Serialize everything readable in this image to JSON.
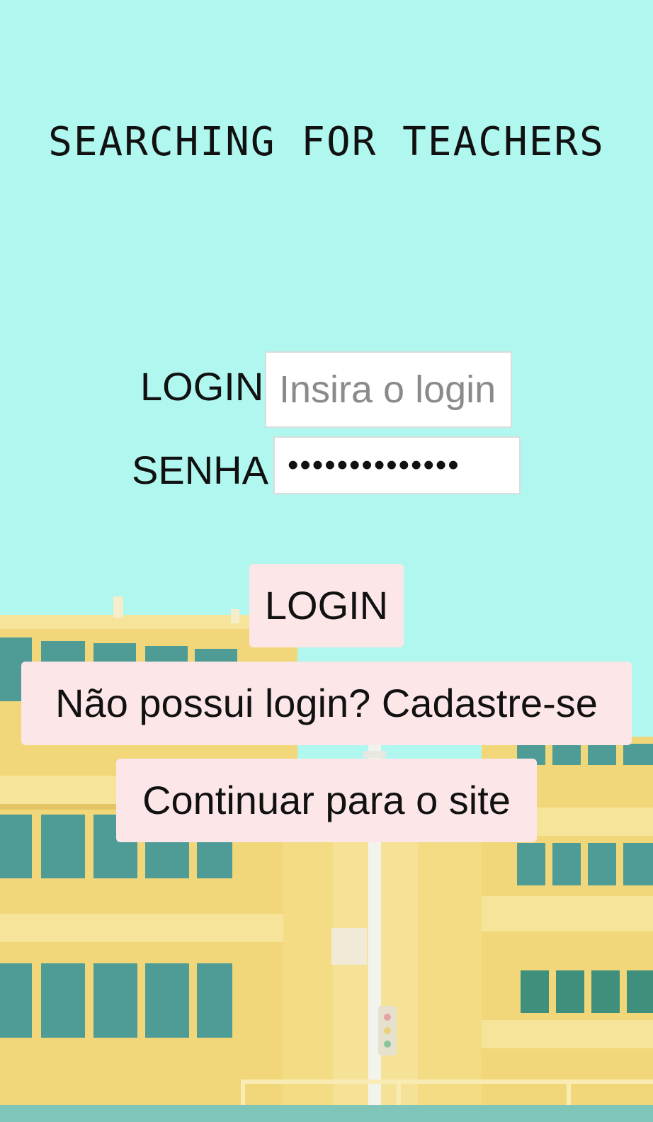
{
  "header": {
    "title": "SEARCHING FOR TEACHERS"
  },
  "login_form": {
    "login_label": "LOGIN",
    "login_placeholder": "Insira o login",
    "senha_label": "SENHA",
    "senha_value": "••••••••••••••"
  },
  "actions": {
    "login_button": "LOGIN",
    "register_button": "Não possui login?  Cadastre-se",
    "continue_button": "Continuar para o site"
  },
  "colors": {
    "sky": "#b0f7ef",
    "building": "#f2d878",
    "button_bg": "#fde6e8",
    "window": "#4e9e9a"
  },
  "background": {
    "illustration": "yellow-school-building"
  }
}
